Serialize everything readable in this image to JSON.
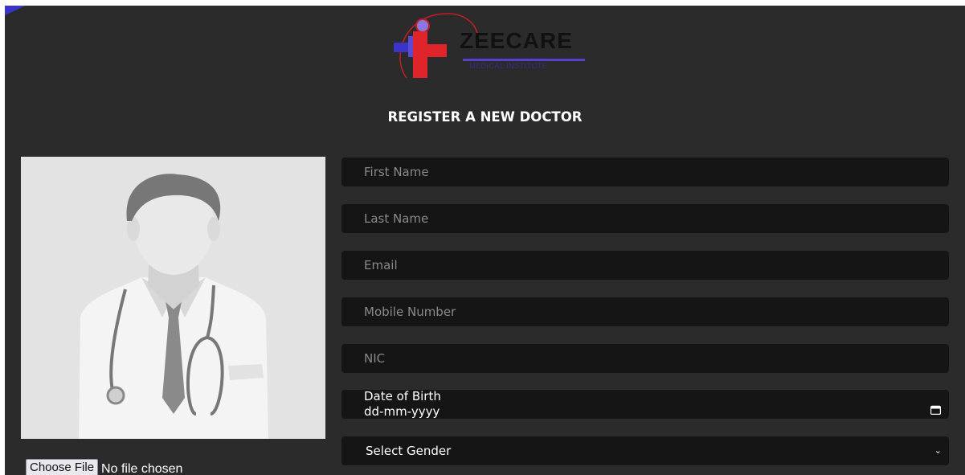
{
  "brand": {
    "name": "ZEECARE",
    "tagline": "MEDICAL INSTITUTE"
  },
  "page_title": "REGISTER A NEW DOCTOR",
  "avatar": {
    "file_button": "Choose File",
    "file_status": "No file chosen"
  },
  "form": {
    "first_name_placeholder": "First Name",
    "last_name_placeholder": "Last Name",
    "email_placeholder": "Email",
    "mobile_placeholder": "Mobile Number",
    "nic_placeholder": "NIC",
    "dob_label": "Date of Birth",
    "dob_value": "dd-mm-yyyy",
    "gender_selected": "Select Gender"
  },
  "colors": {
    "background": "#2b2b2b",
    "field": "#151515",
    "accent_purple": "#3a34c8",
    "logo_red": "#e0242c"
  },
  "icons": [
    "calendar-icon",
    "chevron-down-icon",
    "doctor-avatar"
  ]
}
